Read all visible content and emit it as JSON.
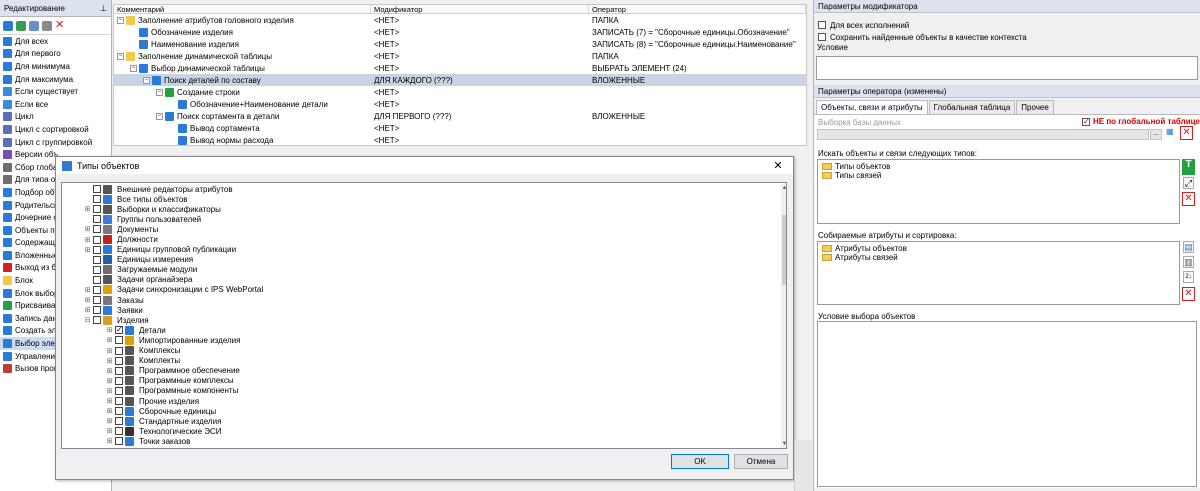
{
  "left_panel": {
    "title": "Редактирование",
    "items": [
      {
        "label": "Для всех",
        "icon": "arrow-all-icon",
        "color": "#2a7bd8"
      },
      {
        "label": "Для первого",
        "icon": "arrow-first-icon",
        "color": "#2a7bd8"
      },
      {
        "label": "Для минимума",
        "icon": "arrow-min-icon",
        "color": "#2a7bd8"
      },
      {
        "label": "Для максимума",
        "icon": "arrow-max-icon",
        "color": "#2a7bd8"
      },
      {
        "label": "Если существует",
        "icon": "branch-icon",
        "color": "#3a8be0"
      },
      {
        "label": "Если все",
        "icon": "branch-all-icon",
        "color": "#3a8be0"
      },
      {
        "label": "Цикл",
        "icon": "loop-icon",
        "color": "#5a6fb8"
      },
      {
        "label": "Цикл с сортировкой",
        "icon": "loop-sort-icon",
        "color": "#5a6fb8"
      },
      {
        "label": "Цикл с группировкой",
        "icon": "loop-group-icon",
        "color": "#5a6fb8"
      },
      {
        "label": "Версии объ",
        "icon": "versions-icon",
        "color": "#7a4fb0"
      },
      {
        "label": "Сбор глоба",
        "icon": "collect-global-icon",
        "color": "#6e6e6e"
      },
      {
        "label": "Для типа об",
        "icon": "type-icon",
        "color": "#6e6e6e"
      },
      {
        "label": "Подбор объ",
        "icon": "selection-icon",
        "color": "#2a7bd8"
      },
      {
        "label": "Родительск",
        "icon": "parent-icon",
        "color": "#2a7bd8"
      },
      {
        "label": "Дочерние о",
        "icon": "children-icon",
        "color": "#2a7bd8"
      },
      {
        "label": "Объекты по",
        "icon": "objects-icon",
        "color": "#2a7bd8"
      },
      {
        "label": "Содержащи",
        "icon": "containing-icon",
        "color": "#2a7bd8"
      },
      {
        "label": "Вложенные",
        "icon": "nested-icon",
        "color": "#2a7bd8"
      },
      {
        "label": "Выход из б",
        "icon": "exit-block-icon",
        "color": "#d42020"
      },
      {
        "label": "Блок",
        "icon": "block-icon",
        "color": "#f2c94c"
      },
      {
        "label": "Блок выбор",
        "icon": "block-select-icon",
        "color": "#2a7bd8"
      },
      {
        "label": "Присваиван",
        "icon": "assign-icon",
        "color": "#23a040"
      },
      {
        "label": "Запись дан",
        "icon": "write-data-icon",
        "color": "#2a7bd8"
      },
      {
        "label": "Создать эле",
        "icon": "create-element-icon",
        "color": "#2a7bd8"
      },
      {
        "label": "Выбор элем",
        "icon": "select-element-icon",
        "color": "#2a7bd8",
        "selected": true
      },
      {
        "label": "Управлени",
        "icon": "manage-icon",
        "color": "#2a7bd8"
      },
      {
        "label": "Вызов прог",
        "icon": "call-program-icon",
        "color": "#c23b3b"
      }
    ]
  },
  "grid": {
    "columns": [
      "Комментарий",
      "Модификатор",
      "Оператор"
    ],
    "rows": [
      {
        "indent": 0,
        "exp": "−",
        "icon": "folder-icon",
        "color": "#f2c94c",
        "comment": "Заполнение атрибутов головного изделия",
        "mod": "<НЕТ>",
        "op": "ПАПКА"
      },
      {
        "indent": 1,
        "exp": "",
        "icon": "write-attr-icon",
        "color": "#2a7bd8",
        "comment": "Обозначение изделия",
        "mod": "<НЕТ>",
        "op": "ЗАПИСАТЬ (7) = \"Сборочные единицы.Обозначение\""
      },
      {
        "indent": 1,
        "exp": "",
        "icon": "write-attr-icon",
        "color": "#2a7bd8",
        "comment": "Наименование изделия",
        "mod": "<НЕТ>",
        "op": "ЗАПИСАТЬ (8) = \"Сборочные единицы.Наименование\""
      },
      {
        "indent": 0,
        "exp": "−",
        "icon": "folder-icon",
        "color": "#f2c94c",
        "comment": "Заполнение динамической таблицы",
        "mod": "<НЕТ>",
        "op": "ПАПКА"
      },
      {
        "indent": 1,
        "exp": "−",
        "icon": "select-element-icon",
        "color": "#2a7bd8",
        "comment": "Выбор динамической таблицы",
        "mod": "<НЕТ>",
        "op": "ВЫБРАТЬ ЭЛЕМЕНТ (24)"
      },
      {
        "indent": 2,
        "exp": "−",
        "icon": "nested-icon",
        "color": "#2a7bd8",
        "comment": "Поиск деталей по составу",
        "mod": "ДЛЯ КАЖДОГО (???)",
        "op": "ВЛОЖЕННЫЕ",
        "selected": true
      },
      {
        "indent": 3,
        "exp": "−",
        "icon": "create-row-icon",
        "color": "#23a040",
        "comment": "Создание строки",
        "mod": "<НЕТ>",
        "op": ""
      },
      {
        "indent": 4,
        "exp": "",
        "icon": "write-attr-icon",
        "color": "#2a7bd8",
        "comment": "Обозначение+Наименование детали",
        "mod": "<НЕТ>",
        "op": ""
      },
      {
        "indent": 3,
        "exp": "−",
        "icon": "nested-icon",
        "color": "#2a7bd8",
        "comment": "Поиск сортамента в детали",
        "mod": "ДЛЯ ПЕРВОГО (???)",
        "op": "ВЛОЖЕННЫЕ"
      },
      {
        "indent": 4,
        "exp": "",
        "icon": "write-attr-icon",
        "color": "#2a7bd8",
        "comment": "Вывод сортамента",
        "mod": "<НЕТ>",
        "op": ""
      },
      {
        "indent": 4,
        "exp": "",
        "icon": "write-attr-icon",
        "color": "#2a7bd8",
        "comment": "Вывод нормы расхода",
        "mod": "<НЕТ>",
        "op": ""
      }
    ]
  },
  "modifier": {
    "title": "Параметры модификатора",
    "for_all_label": "Для всех исполнений",
    "save_found_label": "Сохранить найденные объекты в качестве контекста",
    "condition_label": "Условие",
    "condition_value": ""
  },
  "operator": {
    "title": "Параметры оператора (изменены)",
    "tabs": [
      "Объекты, связи и атрибуты",
      "Глобальная таблица",
      "Прочее"
    ],
    "base_select_label": "Выборка базы данных",
    "not_global_label": "НЕ по глобальной таблице",
    "search_label": "Искать объекты и связи следующих типов:",
    "search_items": [
      "Типы объектов",
      "Типы связей"
    ],
    "attrs_label": "Собираемые атрибуты и сортировка:",
    "attr_items": [
      "Атрибуты объектов",
      "Атрибуты связей"
    ],
    "cond_label": "Условие выбора объектов",
    "browse": "..."
  },
  "dialog": {
    "title": "Типы объектов",
    "close": "✕",
    "ok": "OK",
    "cancel": "Отмена",
    "items": [
      {
        "indent": 1,
        "exp": "",
        "checked": false,
        "icon": "editor-icon",
        "color": "#555",
        "label": "Внешние редакторы атрибутов"
      },
      {
        "indent": 1,
        "exp": "",
        "checked": false,
        "icon": "all-types-icon",
        "color": "#2a7bd8",
        "label": "Все типы объектов"
      },
      {
        "indent": 1,
        "exp": "⊞",
        "checked": false,
        "icon": "catalog-icon",
        "color": "#555",
        "label": "Выборки и классификаторы"
      },
      {
        "indent": 1,
        "exp": "",
        "checked": false,
        "icon": "users-icon",
        "color": "#3a7bd8",
        "label": "Группы пользователей"
      },
      {
        "indent": 1,
        "exp": "⊞",
        "checked": false,
        "icon": "document-icon",
        "color": "#777",
        "label": "Документы"
      },
      {
        "indent": 1,
        "exp": "⊞",
        "checked": false,
        "icon": "position-icon",
        "color": "#c02020",
        "label": "Должности"
      },
      {
        "indent": 1,
        "exp": "⊞",
        "checked": false,
        "icon": "publication-icon",
        "color": "#2a7bd8",
        "label": "Единицы групповой публикации"
      },
      {
        "indent": 1,
        "exp": "",
        "checked": false,
        "icon": "unit-icon",
        "color": "#1a5fb0",
        "label": "Единицы измерения"
      },
      {
        "indent": 1,
        "exp": "",
        "checked": false,
        "icon": "module-icon",
        "color": "#6e6e6e",
        "label": "Загружаемые модули"
      },
      {
        "indent": 1,
        "exp": "",
        "checked": false,
        "icon": "organizer-icon",
        "color": "#555",
        "label": "Задачи органайзера"
      },
      {
        "indent": 1,
        "exp": "⊞",
        "checked": false,
        "icon": "sync-icon",
        "color": "#e0a000",
        "label": "Задачи синхронизации с IPS WebPortal"
      },
      {
        "indent": 1,
        "exp": "⊞",
        "checked": false,
        "icon": "orders-icon",
        "color": "#777",
        "label": "Заказы"
      },
      {
        "indent": 1,
        "exp": "⊞",
        "checked": false,
        "icon": "requests-icon",
        "color": "#2a7bd8",
        "label": "Заявки"
      },
      {
        "indent": 1,
        "exp": "⊟",
        "checked": false,
        "icon": "products-icon",
        "color": "#d4a020",
        "label": "Изделия"
      },
      {
        "indent": 2,
        "exp": "⊞",
        "checked": true,
        "icon": "details-icon",
        "color": "#2a7bd8",
        "label": "Детали"
      },
      {
        "indent": 2,
        "exp": "⊞",
        "checked": false,
        "icon": "imported-icon",
        "color": "#e0a000",
        "label": "Импортированные изделия"
      },
      {
        "indent": 2,
        "exp": "⊞",
        "checked": false,
        "icon": "complexes-icon",
        "color": "#555",
        "label": "Комплексы"
      },
      {
        "indent": 2,
        "exp": "⊞",
        "checked": false,
        "icon": "kits-icon",
        "color": "#555",
        "label": "Комплекты"
      },
      {
        "indent": 2,
        "exp": "⊞",
        "checked": false,
        "icon": "software-icon",
        "color": "#555",
        "label": "Программное обеспечение"
      },
      {
        "indent": 2,
        "exp": "⊞",
        "checked": false,
        "icon": "program-complex-icon",
        "color": "#555",
        "label": "Программные комплексы"
      },
      {
        "indent": 2,
        "exp": "⊞",
        "checked": false,
        "icon": "program-component-icon",
        "color": "#555",
        "label": "Программные компоненты"
      },
      {
        "indent": 2,
        "exp": "⊞",
        "checked": false,
        "icon": "other-products-icon",
        "color": "#555",
        "label": "Прочие изделия"
      },
      {
        "indent": 2,
        "exp": "⊞",
        "checked": false,
        "icon": "assembly-icon",
        "color": "#2a7bd8",
        "label": "Сборочные единицы"
      },
      {
        "indent": 2,
        "exp": "⊞",
        "checked": false,
        "icon": "standard-icon",
        "color": "#2a7bd8",
        "label": "Стандартные изделия"
      },
      {
        "indent": 2,
        "exp": "⊞",
        "checked": false,
        "icon": "tech-esi-icon",
        "color": "#333",
        "label": "Технологические ЭСИ"
      },
      {
        "indent": 2,
        "exp": "⊞",
        "checked": false,
        "icon": "order-points-icon",
        "color": "#2a7bd8",
        "label": "Точки заказов"
      }
    ]
  }
}
